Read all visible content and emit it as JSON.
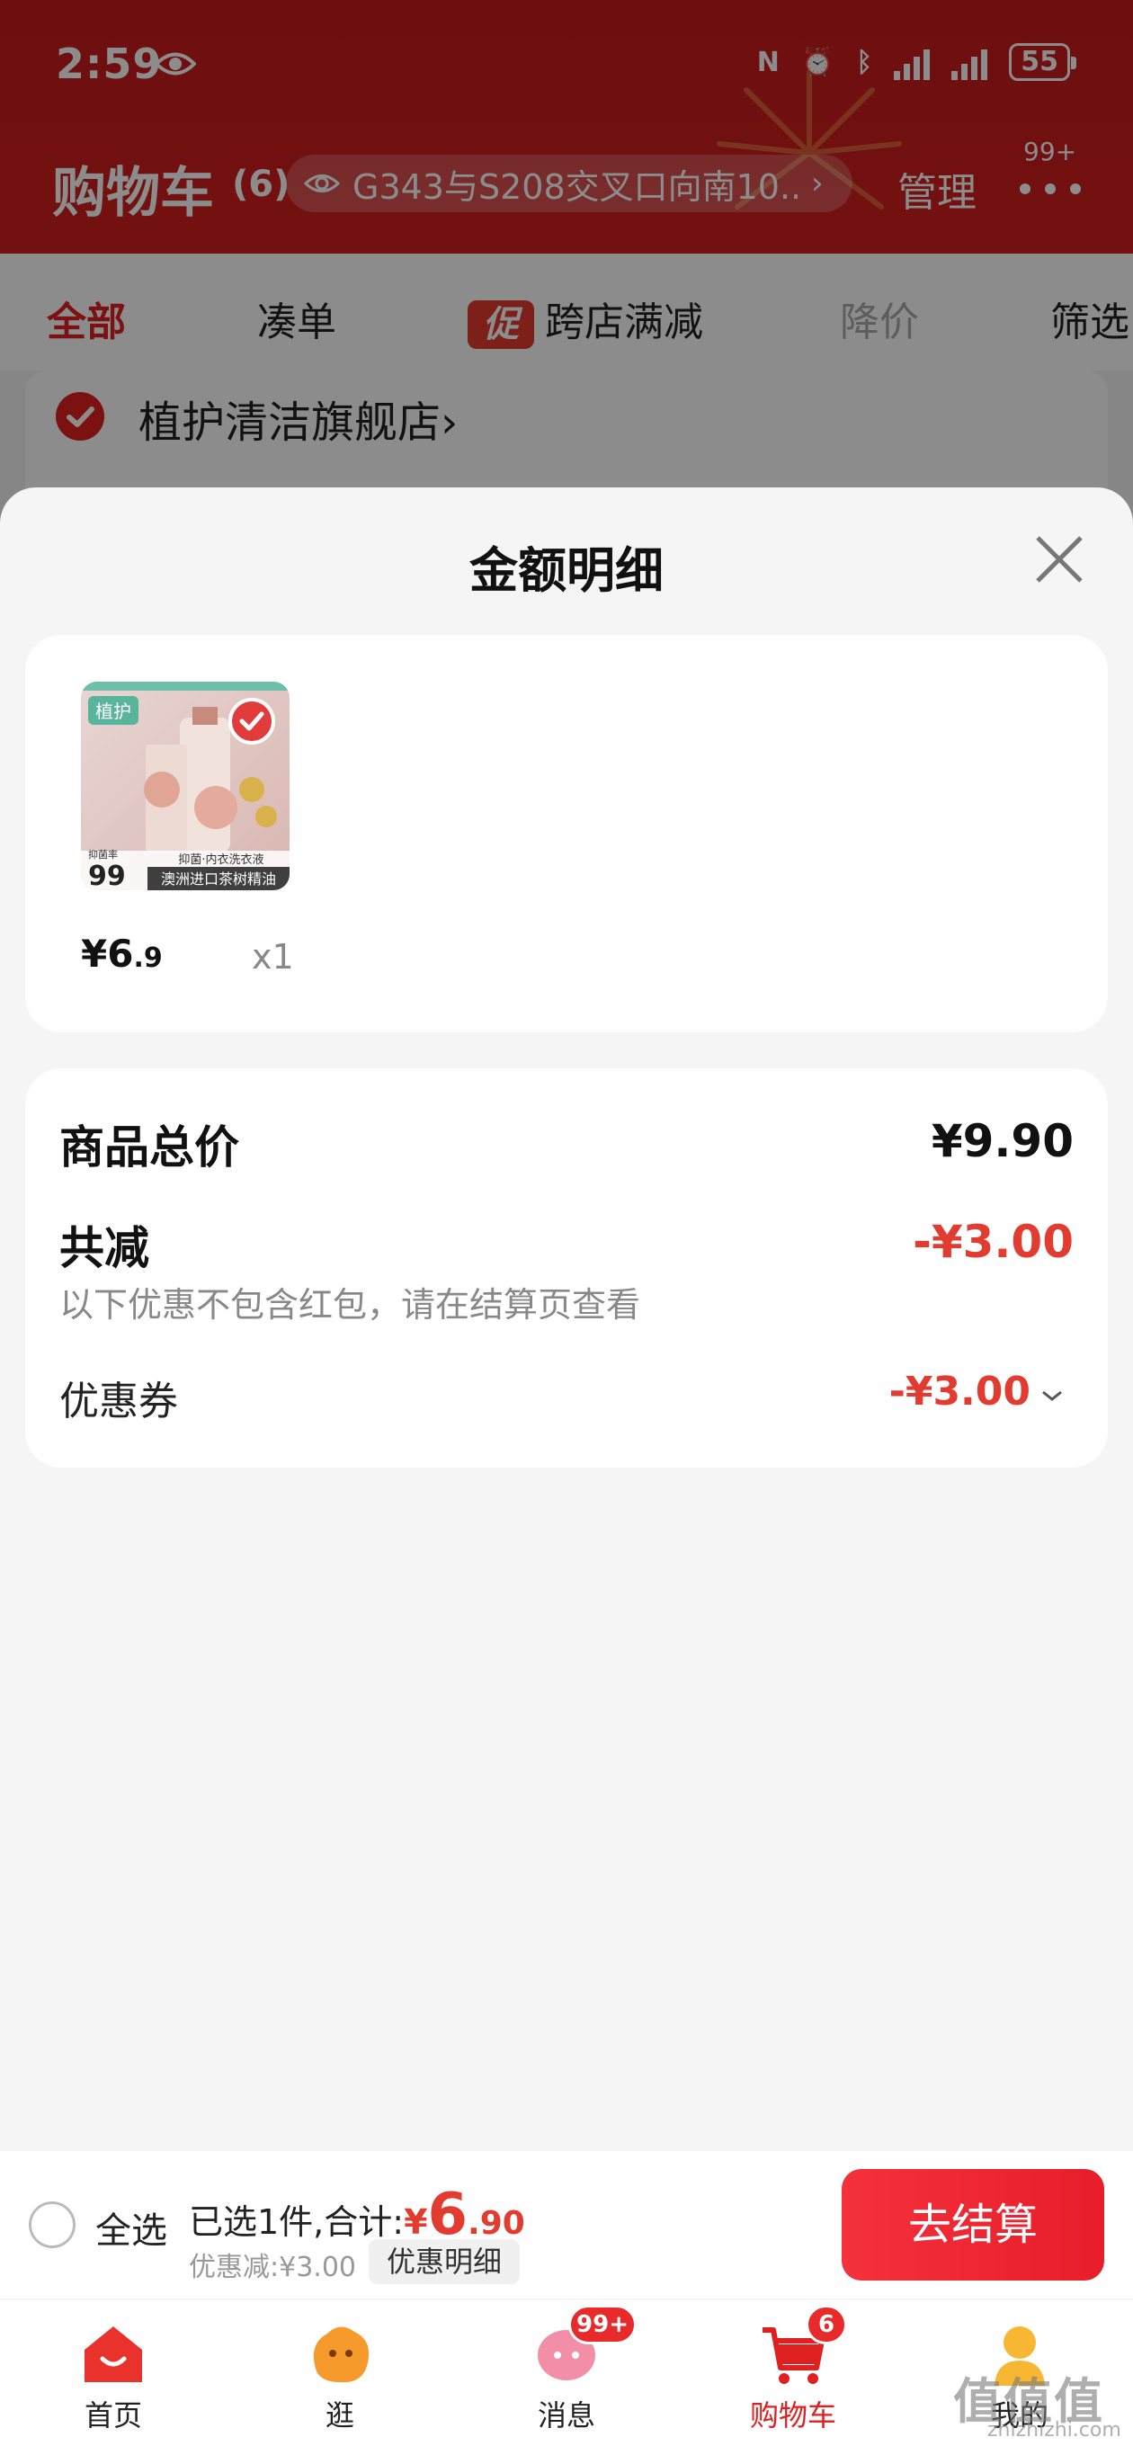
{
  "status_bar": {
    "time": "2:59",
    "battery": "55"
  },
  "header": {
    "title": "购物车",
    "count": "(6)",
    "address": "G343与S208交叉口向南10...",
    "manage_label": "管理",
    "more_badge": "99+"
  },
  "filter_tabs": [
    {
      "label": "全部"
    },
    {
      "label": "凑单"
    },
    {
      "label": "跨店满减",
      "badge": "促"
    },
    {
      "label": "降价"
    },
    {
      "label": "筛选"
    }
  ],
  "store": {
    "name": "植护清洁旗舰店",
    "chevron": "›"
  },
  "sheet": {
    "title": "金额明细",
    "item": {
      "brand": "植护",
      "caption": "澳洲进口茶树精油",
      "sub_caption": "抑菌·内衣洗衣液",
      "rate_label": "抑菌率",
      "rate": "99",
      "price_int": "¥6",
      "price_dec": ".9",
      "qty": "x1"
    },
    "summary": {
      "total_label": "商品总价",
      "total_value": "¥9.90",
      "discount_label": "共减",
      "discount_value": "-¥3.00",
      "discount_note": "以下优惠不包含红包，请在结算页查看",
      "coupon_label": "优惠券",
      "coupon_value": "-¥3.00"
    }
  },
  "checkout": {
    "select_all": "全选",
    "selected_text": "已选1件,合计:",
    "currency": "¥",
    "total_int": "6",
    "total_dec": ".90",
    "discount_text": "优惠减:¥3.00",
    "detail_button": "优惠明细",
    "pay_button": "去结算"
  },
  "tabbar": [
    {
      "label": "首页"
    },
    {
      "label": "逛"
    },
    {
      "label": "消息",
      "badge": "99+"
    },
    {
      "label": "购物车",
      "badge": "6"
    },
    {
      "label": "我的"
    }
  ],
  "watermark": {
    "text": "值值值",
    "sub": "zhizhizhi.com"
  },
  "colors": {
    "brand_red": "#e02020",
    "price_red": "#e23b2f",
    "header_red": "#c81b1b"
  }
}
